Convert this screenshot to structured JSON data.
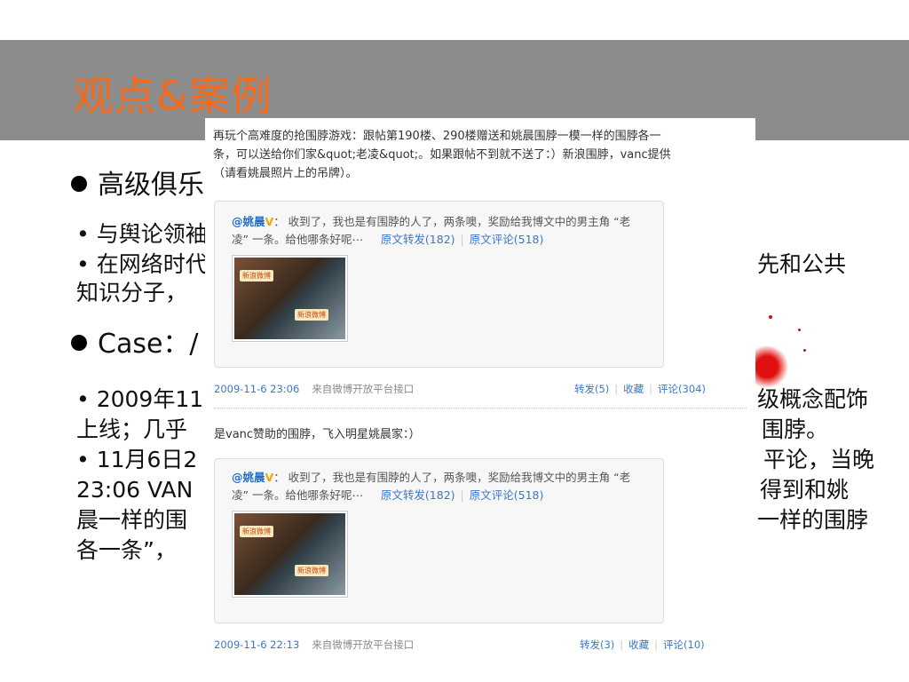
{
  "slide": {
    "title": "观点&案例",
    "bullet1_visible": "高级俱乐",
    "line1_left": "• 与舆论领袖",
    "line2_left": "• 在网络时代",
    "line2_right": "先和公共",
    "line3_left": "知识分子，",
    "bullet2_visible": "Case：/",
    "line4_left": "• 2009年11",
    "line4_right": "级概念配饰",
    "line5_left": "上线；几乎",
    "line5_right": "围脖。",
    "line6_left": "• 11月6日2",
    "line6_right": "平论，当晚",
    "line7_left": "23:06 VAN",
    "line7_right": "得到和姚",
    "line8_left": "晨一样的围",
    "line8_right": "一样的围脖",
    "line9_left": "各一条”，"
  },
  "weibo": {
    "post1": {
      "text_lines": [
        "再玩个高难度的抢围脖游戏：跟帖第190楼、290楼赠送和姚晨围脖一模一样的围脖各一",
        "条，可以送给你们家&quot;老凌&quot;。如果跟帖不到就不送了：）新浪围脖，vanc提供",
        "（请看姚晨照片上的吊牌）。"
      ],
      "quote": {
        "user": "@姚晨",
        "badge": "V",
        "text_a": "：  收到了，我也是有围脖的人了，两条噢，奖励给我博文中的男主角 “老",
        "text_b": "凌” 一条。给他哪条好呢⋯",
        "repost_link": "原文转发(182)",
        "comment_link": "原文评论(518)"
      },
      "thumb_tag": "新浪微博",
      "date": "2009-11-6 23:06",
      "source": "来自微博开放平台接口",
      "repost": "转发(5)",
      "fav": "收藏",
      "comment": "评论(304)"
    },
    "post2": {
      "text": "是vanc赞助的围脖，飞入明星姚晨家：）",
      "quote": {
        "user": "@姚晨",
        "badge": "V",
        "text_a": "：  收到了，我也是有围脖的人了，两条噢，奖励给我博文中的男主角 “老",
        "text_b": "凌” 一条。给他哪条好呢⋯",
        "repost_link": "原文转发(182)",
        "comment_link": "原文评论(518)"
      },
      "thumb_tag": "新浪微博",
      "date": "2009-11-6 22:13",
      "source": "来自微博开放平台接口",
      "repost": "转发(3)",
      "fav": "收藏",
      "comment": "评论(10)"
    }
  }
}
